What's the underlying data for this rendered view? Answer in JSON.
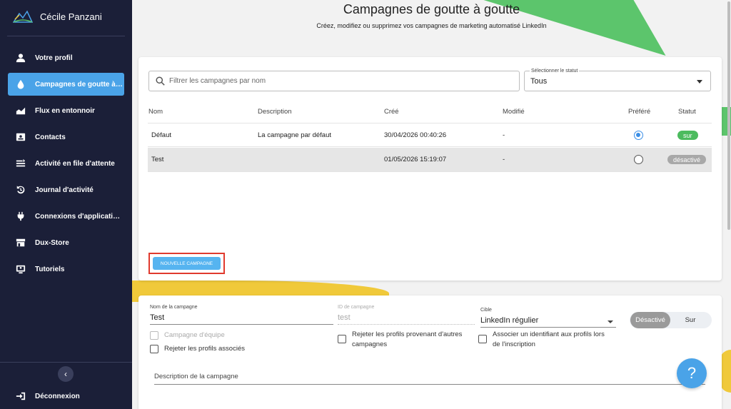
{
  "app": {
    "user_name": "Cécile Panzani"
  },
  "sidebar": {
    "items": [
      {
        "label": "Votre profil",
        "icon": "user-icon"
      },
      {
        "label": "Campagnes de goutte à goutte",
        "icon": "drop-icon",
        "active": true
      },
      {
        "label": "Flux en entonnoir",
        "icon": "area-chart-icon"
      },
      {
        "label": "Contacts",
        "icon": "contact-card-icon"
      },
      {
        "label": "Activité en file d'attente",
        "icon": "queue-list-icon"
      },
      {
        "label": "Journal d'activité",
        "icon": "history-icon"
      },
      {
        "label": "Connexions d'applications",
        "icon": "plug-icon"
      },
      {
        "label": "Dux-Store",
        "icon": "store-icon"
      },
      {
        "label": "Tutoriels",
        "icon": "tutorial-icon"
      }
    ],
    "collapse_glyph": "‹",
    "logout_label": "Déconnexion"
  },
  "header": {
    "title": "Campagnes de goutte à goutte",
    "subtitle": "Créez, modifiez ou supprimez vos campagnes de marketing automatisé LinkedIn"
  },
  "campaigns": {
    "search_placeholder": "Filtrer les campagnes par nom",
    "status_filter": {
      "label": "Sélectionner le statut",
      "value": "Tous"
    },
    "columns": [
      "Nom",
      "Description",
      "Créé",
      "Modifié",
      "Préféré",
      "Statut"
    ],
    "rows": [
      {
        "name": "Défaut",
        "description": "La campagne par défaut",
        "created": "30/04/2026 00:40:26",
        "modified": "-",
        "preferred": true,
        "status": "sur"
      },
      {
        "name": "Test",
        "description": "",
        "created": "01/05/2026 15:19:07",
        "modified": "-",
        "preferred": false,
        "status": "désactivé"
      }
    ],
    "new_button_label": "NOUVELLE CAMPAGNE"
  },
  "editor": {
    "name_label": "Nom de la campagne",
    "name_value": "Test",
    "id_label": "ID de campagne",
    "id_value": "test",
    "target_label": "Cible",
    "target_value": "LinkedIn régulier",
    "toggle_off": "Désactivé",
    "toggle_on": "Sur",
    "cb_team": "Campagne d'équipe",
    "cb_reject_associated": "Rejeter les profils associés",
    "cb_reject_other": "Rejeter les profils provenant d'autres campagnes",
    "cb_assign_id": "Associer un identifiant aux profils lors de l'inscription",
    "description_label": "Description de la campagne"
  },
  "help": {
    "glyph": "?"
  },
  "colors": {
    "sidebar_bg": "#1b1f38",
    "accent": "#4aa3e8",
    "status_on": "#4cbb5e",
    "status_off": "#a8a8a8"
  }
}
